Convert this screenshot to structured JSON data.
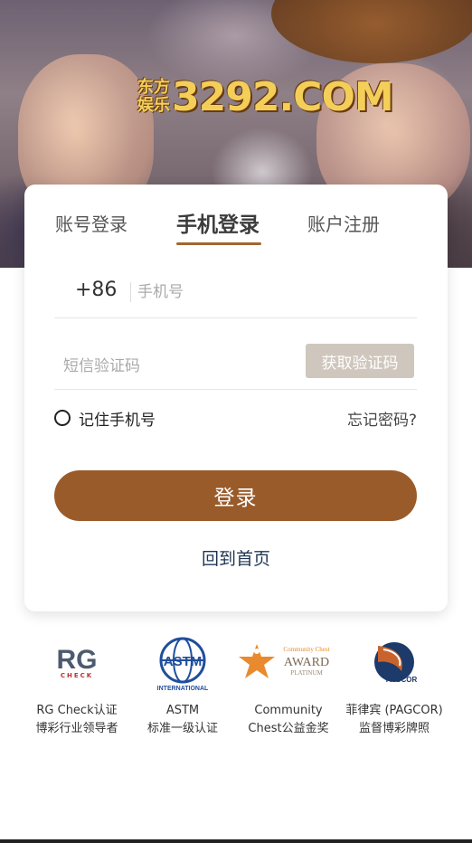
{
  "hero": {
    "logo_small_top": "东方",
    "logo_small_bottom": "娱乐",
    "logo_main": "3292.COM"
  },
  "tabs": [
    {
      "label": "账号登录",
      "active": false
    },
    {
      "label": "手机登录",
      "active": true
    },
    {
      "label": "账户注册",
      "active": false
    }
  ],
  "form": {
    "country_code": "+86",
    "phone_placeholder": "手机号",
    "phone_value": "",
    "code_placeholder": "短信验证码",
    "code_value": "",
    "get_code_label": "获取验证码",
    "remember_label": "记住手机号",
    "remember_checked": false,
    "forgot_label": "忘记密码?",
    "login_label": "登录",
    "home_label": "回到首页"
  },
  "certifications": [
    {
      "logo_text": "RG",
      "logo_sub": "CHECK",
      "line1": "RG Check认证",
      "line2": "博彩行业领导者"
    },
    {
      "logo_text": "ASTM",
      "logo_sub": "INTERNATIONAL",
      "line1": "ASTM",
      "line2": "标准一级认证"
    },
    {
      "logo_text": "AWARD",
      "logo_sub": "Community Chest",
      "logo_sub2": "PLATINUM",
      "line1": "Community",
      "line2": "Chest公益金奖"
    },
    {
      "logo_text": "PAGCOR",
      "line1": "菲律宾 (PAGCOR)",
      "line2": "监督博彩牌照"
    }
  ],
  "colors": {
    "accent": "#9a5b2a",
    "tab_underline": "#a0682f",
    "get_code_bg": "#cfc7bd",
    "link": "#1e3552"
  }
}
